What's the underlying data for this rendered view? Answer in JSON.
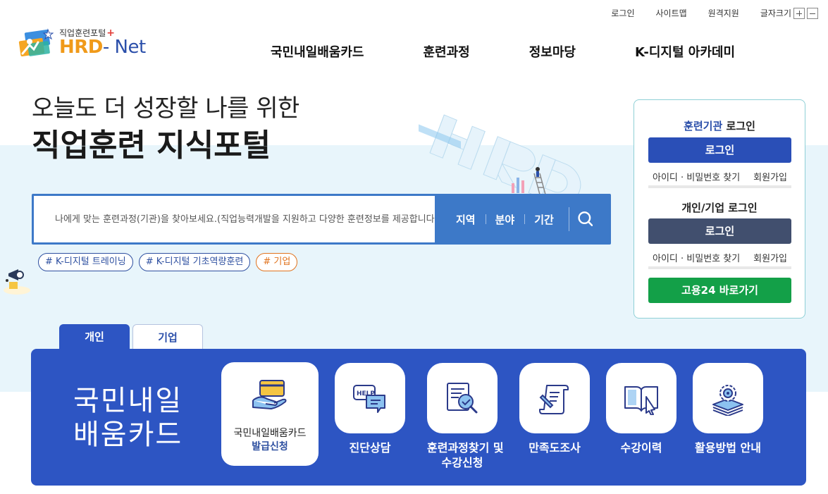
{
  "utility": {
    "login": "로그인",
    "sitemap": "사이트맵",
    "remote": "원격지원",
    "font_size": "글자크기"
  },
  "logo": {
    "small": "직업훈련포털",
    "plus": "+",
    "big_a": "HRD",
    "big_b": "- Net"
  },
  "gnb": [
    "국민내일배움카드",
    "훈련과정",
    "정보마당",
    "K-디지털 아카데미"
  ],
  "hero": {
    "line1": "오늘도 더 성장할 나를 위한",
    "line2": "직업훈련 지식포털"
  },
  "search": {
    "placeholder": "나에게 맞는 훈련과정(기관)을 찾아보세요.(직업능력개발을 지원하고 다양한 훈련정보를 제공합니다.)",
    "options": [
      "지역",
      "분야",
      "기간"
    ]
  },
  "tags": [
    "# K-디지털 트레이닝",
    "# K-디지털 기초역량훈련",
    "# 기업"
  ],
  "login_panel": {
    "org_title_accent": "훈련기관",
    "org_title_rest": " 로그인",
    "org_login": "로그인",
    "org_find": "아이디 · 비밀번호 찾기",
    "org_join": "회원가입",
    "personal_title": "개인/기업 로그인",
    "personal_login": "로그인",
    "personal_find": "아이디 · 비밀번호 찾기",
    "personal_join": "회원가입",
    "goyong24": "고용24 바로가기"
  },
  "tabs": [
    "개인",
    "기업"
  ],
  "card": {
    "title_line1": "국민내일",
    "title_line2": "배움카드",
    "feature_line1": "국민내일배움카드",
    "feature_line2": "발급신청",
    "services": [
      "진단상담",
      "훈련과정찾기 및",
      "수강신청",
      "만족도조사",
      "수강이력",
      "활용방법 안내"
    ]
  },
  "colors": {
    "brand_blue": "#2d55c3",
    "search_blue": "#3d79c8",
    "green": "#13a048",
    "orange": "#e0731e"
  }
}
